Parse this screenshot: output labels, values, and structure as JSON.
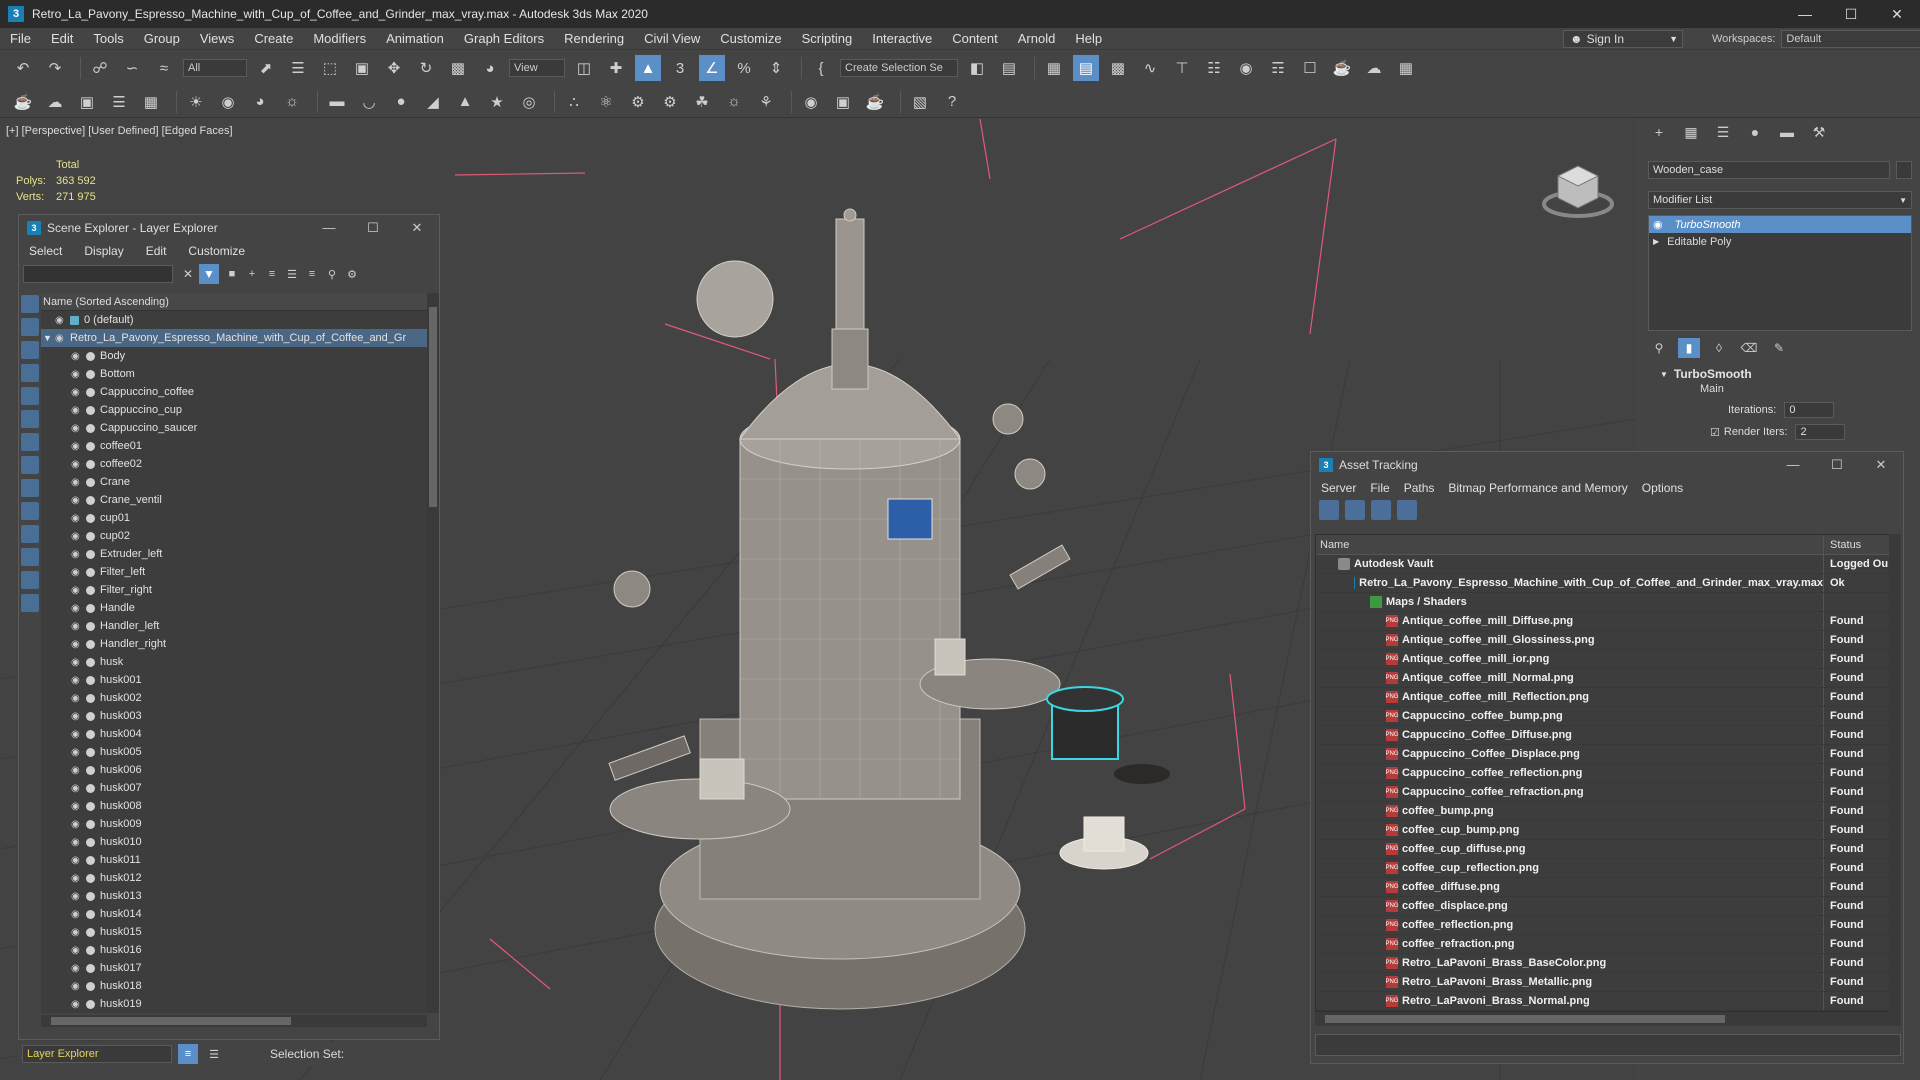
{
  "app": {
    "window_title": "Retro_La_Pavony_Espresso_Machine_with_Cup_of_Coffee_and_Grinder_max_vray.max - Autodesk 3ds Max 2020",
    "icon_glyph": "3"
  },
  "menu": [
    "File",
    "Edit",
    "Tools",
    "Group",
    "Views",
    "Create",
    "Modifiers",
    "Animation",
    "Graph Editors",
    "Rendering",
    "Civil View",
    "Customize",
    "Scripting",
    "Interactive",
    "Content",
    "Arnold",
    "Help"
  ],
  "signin": "Sign In",
  "workspaces": {
    "label": "Workspaces:",
    "value": "Default"
  },
  "toolbar": {
    "filter_value": "All",
    "view_value": "View",
    "selection_set_placeholder": "Create Selection Se"
  },
  "viewport": {
    "label": "[+] [Perspective] [User Defined] [Edged Faces]",
    "stats_total": "Total",
    "polys_label": "Polys:",
    "polys_value": "363 592",
    "verts_label": "Verts:",
    "verts_value": "271 975"
  },
  "scene_explorer": {
    "title": "Scene Explorer - Layer Explorer",
    "menu": [
      "Select",
      "Display",
      "Edit",
      "Customize"
    ],
    "column_header": "Name (Sorted Ascending)",
    "layers": [
      "0 (default)",
      "Retro_La_Pavony_Espresso_Machine_with_Cup_of_Coffee_and_Gr"
    ],
    "objects": [
      "Body",
      "Bottom",
      "Cappuccino_coffee",
      "Cappuccino_cup",
      "Cappuccino_saucer",
      "coffee01",
      "coffee02",
      "Crane",
      "Crane_ventil",
      "cup01",
      "cup02",
      "Extruder_left",
      "Filter_left",
      "Filter_right",
      "Handle",
      "Handler_left",
      "Handler_right",
      "husk",
      "husk001",
      "husk002",
      "husk003",
      "husk004",
      "husk005",
      "husk006",
      "husk007",
      "husk008",
      "husk009",
      "husk010",
      "husk011",
      "husk012",
      "husk013",
      "husk014",
      "husk015",
      "husk016",
      "husk017",
      "husk018",
      "husk019"
    ],
    "footer_layer": "Layer Explorer",
    "footer_selection_set": "Selection Set:"
  },
  "command_panel": {
    "object_name": "Wooden_case",
    "modifier_list": "Modifier List",
    "stack": [
      "TurboSmooth",
      "Editable Poly"
    ],
    "rollout_title": "TurboSmooth",
    "rollout_section": "Main",
    "iterations_label": "Iterations:",
    "iterations_value": "0",
    "render_iters_label": "Render Iters:",
    "render_iters_value": "2"
  },
  "asset_tracking": {
    "title": "Asset Tracking",
    "menu": [
      "Server",
      "File",
      "Paths",
      "Bitmap Performance and Memory",
      "Options"
    ],
    "columns": [
      "Name",
      "Status"
    ],
    "vault": {
      "name": "Autodesk Vault",
      "status": "Logged Ou"
    },
    "scene_file": {
      "name": "Retro_La_Pavony_Espresso_Machine_with_Cup_of_Coffee_and_Grinder_max_vray.max",
      "status": "Ok"
    },
    "maps_folder": "Maps / Shaders",
    "files": [
      {
        "name": "Antique_coffee_mill_Diffuse.png",
        "status": "Found"
      },
      {
        "name": "Antique_coffee_mill_Glossiness.png",
        "status": "Found"
      },
      {
        "name": "Antique_coffee_mill_ior.png",
        "status": "Found"
      },
      {
        "name": "Antique_coffee_mill_Normal.png",
        "status": "Found"
      },
      {
        "name": "Antique_coffee_mill_Reflection.png",
        "status": "Found"
      },
      {
        "name": "Cappuccino_coffee_bump.png",
        "status": "Found"
      },
      {
        "name": "Cappuccino_Coffee_Diffuse.png",
        "status": "Found"
      },
      {
        "name": "Cappuccino_Coffee_Displace.png",
        "status": "Found"
      },
      {
        "name": "Cappuccino_coffee_reflection.png",
        "status": "Found"
      },
      {
        "name": "Cappuccino_coffee_refraction.png",
        "status": "Found"
      },
      {
        "name": "coffee_bump.png",
        "status": "Found"
      },
      {
        "name": "coffee_cup_bump.png",
        "status": "Found"
      },
      {
        "name": "coffee_cup_diffuse.png",
        "status": "Found"
      },
      {
        "name": "coffee_cup_reflection.png",
        "status": "Found"
      },
      {
        "name": "coffee_diffuse.png",
        "status": "Found"
      },
      {
        "name": "coffee_displace.png",
        "status": "Found"
      },
      {
        "name": "coffee_reflection.png",
        "status": "Found"
      },
      {
        "name": "coffee_refraction.png",
        "status": "Found"
      },
      {
        "name": "Retro_LaPavoni_Brass_BaseColor.png",
        "status": "Found"
      },
      {
        "name": "Retro_LaPavoni_Brass_Metallic.png",
        "status": "Found"
      },
      {
        "name": "Retro_LaPavoni_Brass_Normal.png",
        "status": "Found"
      }
    ]
  },
  "colors": {
    "accent": "#5b8fc7",
    "stats_text": "#e8e28a",
    "layer_select_text": "#e8d45a",
    "grid_line": "#e05a78"
  }
}
